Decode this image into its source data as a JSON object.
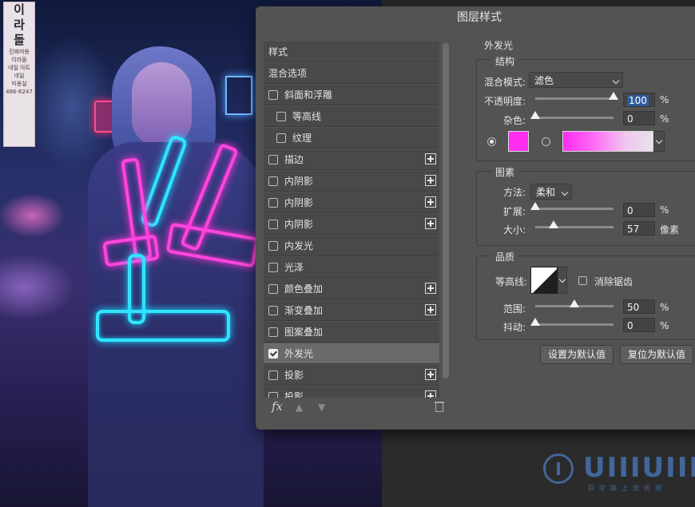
{
  "dialog": {
    "title": "图层样式"
  },
  "background": {
    "sign_chars": [
      "이",
      "라",
      "돌"
    ],
    "sign_small": [
      "진짜미용",
      "이라돌",
      "네일 아트",
      "네일",
      "미용실",
      "486-6247"
    ]
  },
  "style_list": {
    "items": [
      {
        "label": "样式",
        "kind": "plain",
        "checked": false,
        "has_plus": false,
        "selected": false
      },
      {
        "label": "混合选项",
        "kind": "plain",
        "checked": false,
        "has_plus": false,
        "selected": false
      },
      {
        "label": "斜面和浮雕",
        "kind": "check",
        "checked": false,
        "has_plus": false,
        "selected": false
      },
      {
        "label": "等高线",
        "kind": "indent",
        "checked": false,
        "has_plus": false,
        "selected": false
      },
      {
        "label": "纹理",
        "kind": "indent",
        "checked": false,
        "has_plus": false,
        "selected": false
      },
      {
        "label": "描边",
        "kind": "check",
        "checked": false,
        "has_plus": true,
        "selected": false
      },
      {
        "label": "内阴影",
        "kind": "check",
        "checked": false,
        "has_plus": true,
        "selected": false
      },
      {
        "label": "内阴影",
        "kind": "check",
        "checked": false,
        "has_plus": true,
        "selected": false
      },
      {
        "label": "内阴影",
        "kind": "check",
        "checked": false,
        "has_plus": true,
        "selected": false
      },
      {
        "label": "内发光",
        "kind": "check",
        "checked": false,
        "has_plus": false,
        "selected": false
      },
      {
        "label": "光泽",
        "kind": "check",
        "checked": false,
        "has_plus": false,
        "selected": false
      },
      {
        "label": "颜色叠加",
        "kind": "check",
        "checked": false,
        "has_plus": true,
        "selected": false
      },
      {
        "label": "渐变叠加",
        "kind": "check",
        "checked": false,
        "has_plus": true,
        "selected": false
      },
      {
        "label": "图案叠加",
        "kind": "check",
        "checked": false,
        "has_plus": false,
        "selected": false
      },
      {
        "label": "外发光",
        "kind": "check",
        "checked": true,
        "has_plus": false,
        "selected": true
      },
      {
        "label": "投影",
        "kind": "check",
        "checked": false,
        "has_plus": true,
        "selected": false
      },
      {
        "label": "投影",
        "kind": "check",
        "checked": false,
        "has_plus": true,
        "selected": false
      }
    ],
    "fx_label": "fx",
    "icons": {
      "fx": "fx-icon",
      "up": "arrow-up-icon",
      "down": "arrow-down-icon",
      "delete": "trash-icon"
    }
  },
  "outer_glow": {
    "heading": "外发光",
    "structure": {
      "title": "结构",
      "blend_mode_label": "混合模式:",
      "blend_mode_value": "滤色",
      "opacity_label": "不透明度:",
      "opacity_value": "100",
      "opacity_fraction": 1.0,
      "noise_label": "杂色:",
      "noise_value": "0",
      "noise_fraction": 0.0,
      "percent": "%",
      "color": "#ff2ef0"
    },
    "elements": {
      "title": "图素",
      "technique_label": "方法:",
      "technique_value": "柔和",
      "spread_label": "扩展:",
      "spread_value": "0",
      "spread_fraction": 0.0,
      "size_label": "大小:",
      "size_value": "57",
      "size_fraction": 0.23,
      "percent": "%",
      "pixels": "像素"
    },
    "quality": {
      "title": "品质",
      "contour_label": "等高线:",
      "antialias_label": "消除锯齿",
      "range_label": "范围:",
      "range_value": "50",
      "range_fraction": 0.5,
      "jitter_label": "抖动:",
      "jitter_value": "0",
      "jitter_fraction": 0.0,
      "percent": "%"
    },
    "buttons": {
      "make_default": "设置为默认值",
      "reset_default": "复位为默认值"
    }
  },
  "watermark": {
    "text": "UIIIUIII",
    "sub": "目学路上优优网"
  },
  "colors": {
    "dialog_bg": "#535353",
    "selected_row": "#6a6a6a",
    "highlight": "#2e5c9c",
    "glow_pink": "#ff2ef0",
    "glow_cyan": "#2fe6ff"
  }
}
